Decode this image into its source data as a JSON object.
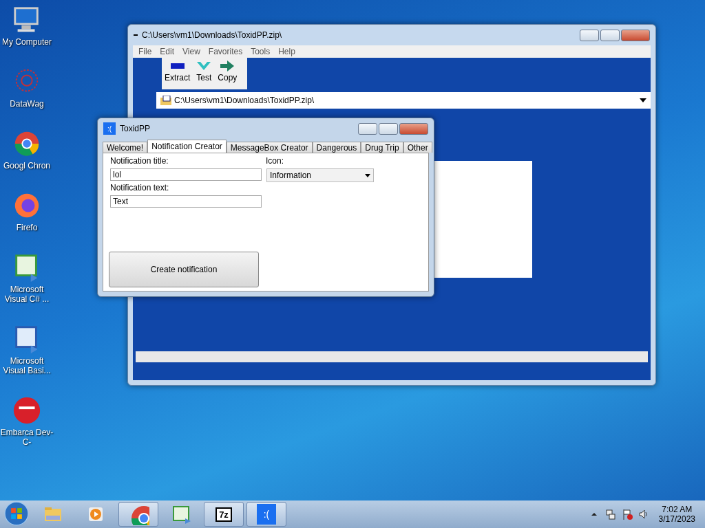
{
  "desktop_icons": [
    {
      "label": "My Computer",
      "kind": "computer"
    },
    {
      "label": "DataWag",
      "kind": "network"
    },
    {
      "label": "Googl Chron",
      "kind": "chrome"
    },
    {
      "label": "Firefo",
      "kind": "firefox"
    },
    {
      "label": "Microsoft Visual C# ...",
      "kind": "csharp"
    },
    {
      "label": "Microsoft Visual Basi...",
      "kind": "vb"
    },
    {
      "label": "Embarca Dev-C-",
      "kind": "devcpp"
    }
  ],
  "archive_window": {
    "title": "C:\\Users\\vm1\\Downloads\\ToxidPP.zip\\",
    "menu": [
      "File",
      "Edit",
      "View",
      "Favorites",
      "Tools",
      "Help"
    ],
    "toolbar": [
      {
        "label": "Extract",
        "kind": "extract"
      },
      {
        "label": "Test",
        "kind": "test"
      },
      {
        "label": "Copy",
        "kind": "copy"
      }
    ],
    "address": "C:\\Users\\vm1\\Downloads\\ToxidPP.zip\\"
  },
  "app_window": {
    "title": "ToxidPP",
    "logo": ":(",
    "tabs": [
      {
        "label": "Welcome!",
        "selected": false
      },
      {
        "label": "Notification Creator",
        "selected": true
      },
      {
        "label": "MessageBox Creator",
        "selected": false
      },
      {
        "label": "Dangerous",
        "selected": false
      },
      {
        "label": "Drug Trip",
        "selected": false
      },
      {
        "label": "Other",
        "selected": false
      }
    ],
    "title_label": "Notification title:",
    "title_value": "lol",
    "text_label": "Notification text:",
    "text_value": "Text",
    "icon_label": "Icon:",
    "icon_value": "Information",
    "button": "Create notification"
  },
  "taskbar": {
    "apps": [
      {
        "kind": "explorer",
        "running": false
      },
      {
        "kind": "media",
        "running": false
      },
      {
        "kind": "chrome",
        "running": true
      },
      {
        "kind": "csharp",
        "running": false
      },
      {
        "kind": "sevenzip",
        "running": true,
        "text": "7z"
      },
      {
        "kind": "toxid",
        "running": true,
        "text": ":("
      }
    ],
    "time": "7:02 AM",
    "date": "3/17/2023"
  }
}
